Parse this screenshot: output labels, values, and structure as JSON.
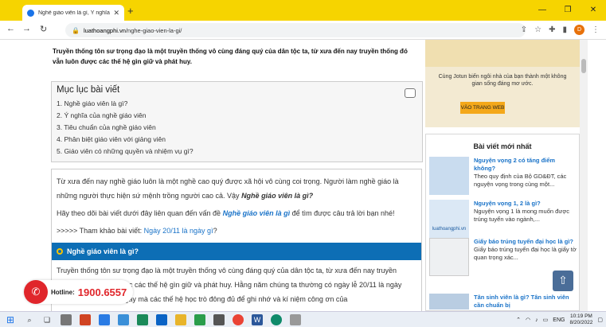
{
  "browser": {
    "tab_title": "Nghề giáo viên là gì, Ý nghĩa của",
    "new_tab": "+",
    "url_host": "luathoangphi.vn",
    "url_path": "/nghe-giao-vien-la-gi/",
    "avatar_letter": "D",
    "win_min": "—",
    "win_restore": "❐",
    "win_close": "✕"
  },
  "page": {
    "intro": "Truyền thống tôn sư trọng đạo là một truyền thống vô cùng đáng quý của dân tộc ta, từ xưa đến nay truyền thống đó vẫn luôn được các thế hệ gìn giữ và phát huy.",
    "toc": {
      "title": "Mục lục bài viết",
      "items": [
        "1. Nghề giáo viên là gì?",
        "2. Ý nghĩa của nghề giáo viên",
        "3. Tiêu chuẩn của nghề giáo viên",
        "4. Phân biệt giáo viên với giảng viên",
        "5. Giáo viên có những quyền và nhiệm vụ gì?"
      ]
    },
    "article": {
      "p1_a": "Từ xưa đến nay nghề giáo luôn là một nghề cao quý được xã hội vô cùng coi trọng. Người làm nghề giáo là những người thực hiện sứ mệnh trồng người cao cả. Vậy ",
      "p1_em": "Nghề giáo viên là gì?",
      "p2_a": "Hãy theo dõi bài viết dưới đây liên quan đến vấn đề ",
      "p2_kw": "Nghề giáo viên là gì",
      "p2_b": " để tìm được câu trả lời bạn nhé!",
      "p3_a": ">>>>> Tham khảo bài viết: ",
      "p3_link": "Ngày 20/11 là ngày gì",
      "p3_b": "?",
      "h2": "Nghề giáo viên là gì?",
      "p4": "Truyền thống tôn sư trọng đạo là một truyền thống vô cùng đáng quý của dân tộc ta, từ xưa đến nay truyền thống đó vẫn luôn được các thế hệ gìn giữ và phát huy. Hằng năm chúng ta thường có ngày lễ 20/11 là ngày Nhà giáo Việt Nam, ngày mà các thế hệ học trò đông đủ để ghi nhớ và kí niệm công ơn của"
    },
    "sidebar": {
      "ad_text": "Cùng Jotun biến ngôi nhà của bạn thành một không gian sống đáng mơ ước.",
      "ad_button": "VÀO TRANG WEB",
      "recent_title": "Bài viết mới nhất",
      "posts": [
        {
          "title": "Nguyện vọng 2 có tăng điểm không?",
          "desc": "Theo quy định của Bộ GD&ĐT, các nguyện vọng trong cùng một..."
        },
        {
          "title": "Nguyện vọng 1, 2 là gì?",
          "desc": "Nguyện vọng 1 là mong muốn được trúng tuyển vào ngành,..."
        },
        {
          "title": "Giấy báo trúng tuyển đại học là gì?",
          "desc": "Giấy báo trúng tuyển đại học là giấy tờ quan trọng xác..."
        },
        {
          "title": "Tân sinh viên là gì? Tân sinh viên cần chuẩn bị",
          "desc": ""
        }
      ],
      "thumb2_label": "luathoangphi.vn"
    },
    "hotline_label": "Hotline:",
    "hotline_number": "1900.6557"
  },
  "taskbar": {
    "lang": "ENG",
    "time": "10:19 PM",
    "date": "8/20/2022"
  },
  "colors": {
    "tabbar": "#f6d400",
    "heading_bar": "#0d6eb5",
    "link": "#1a73c8",
    "hotline": "#e0262b"
  }
}
